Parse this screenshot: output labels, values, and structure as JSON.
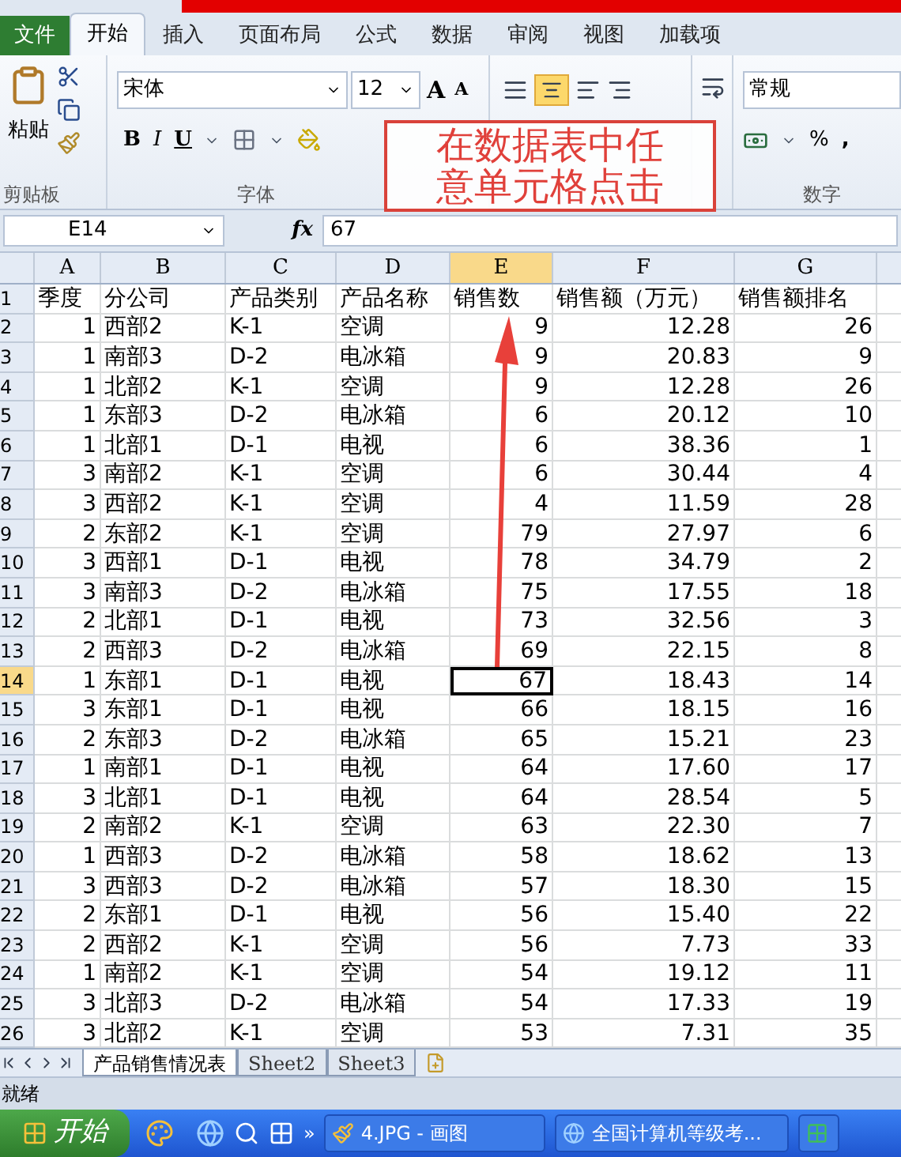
{
  "ribbon_tabs": [
    {
      "label": "文件",
      "kind": "file",
      "selected": false
    },
    {
      "label": "开始",
      "kind": "tab",
      "selected": true
    },
    {
      "label": "插入",
      "kind": "tab",
      "selected": false
    },
    {
      "label": "页面布局",
      "kind": "tab",
      "selected": false
    },
    {
      "label": "公式",
      "kind": "tab",
      "selected": false
    },
    {
      "label": "数据",
      "kind": "tab",
      "selected": false
    },
    {
      "label": "审阅",
      "kind": "tab",
      "selected": false
    },
    {
      "label": "视图",
      "kind": "tab",
      "selected": false
    },
    {
      "label": "加载项",
      "kind": "tab",
      "selected": false
    }
  ],
  "clipboard": {
    "paste": "粘贴",
    "group": "剪贴板"
  },
  "font": {
    "name": "宋体",
    "size": "12",
    "group": "字体",
    "style_buttons": [
      "B",
      "I",
      "U"
    ],
    "grow": "A",
    "shrink": "A"
  },
  "number": {
    "format": "常规",
    "group": "数字",
    "percent": "%",
    "comma": ","
  },
  "name_box": "E14",
  "fx": "fx",
  "formula": "67",
  "columns": [
    {
      "label": "A",
      "selected": false
    },
    {
      "label": "B",
      "selected": false
    },
    {
      "label": "C",
      "selected": false
    },
    {
      "label": "D",
      "selected": false
    },
    {
      "label": "E",
      "selected": true
    },
    {
      "label": "F",
      "selected": false
    },
    {
      "label": "G",
      "selected": false
    }
  ],
  "rows": [
    {
      "num": "1",
      "selected": false,
      "cells": [
        "季度",
        "分公司",
        "产品类别",
        "产品名称",
        "销售数",
        "销售额（万元）",
        "销售额排名"
      ]
    },
    {
      "num": "2",
      "selected": false,
      "cells": [
        "1",
        "西部2",
        "K-1",
        "空调",
        "9",
        "12.28",
        "26"
      ]
    },
    {
      "num": "3",
      "selected": false,
      "cells": [
        "1",
        "南部3",
        "D-2",
        "电冰箱",
        "9",
        "20.83",
        "9"
      ]
    },
    {
      "num": "4",
      "selected": false,
      "cells": [
        "1",
        "北部2",
        "K-1",
        "空调",
        "9",
        "12.28",
        "26"
      ]
    },
    {
      "num": "5",
      "selected": false,
      "cells": [
        "1",
        "东部3",
        "D-2",
        "电冰箱",
        "6",
        "20.12",
        "10"
      ]
    },
    {
      "num": "6",
      "selected": false,
      "cells": [
        "1",
        "北部1",
        "D-1",
        "电视",
        "6",
        "38.36",
        "1"
      ]
    },
    {
      "num": "7",
      "selected": false,
      "cells": [
        "3",
        "南部2",
        "K-1",
        "空调",
        "6",
        "30.44",
        "4"
      ]
    },
    {
      "num": "8",
      "selected": false,
      "cells": [
        "3",
        "西部2",
        "K-1",
        "空调",
        "4",
        "11.59",
        "28"
      ]
    },
    {
      "num": "9",
      "selected": false,
      "cells": [
        "2",
        "东部2",
        "K-1",
        "空调",
        "79",
        "27.97",
        "6"
      ]
    },
    {
      "num": "10",
      "selected": false,
      "cells": [
        "3",
        "西部1",
        "D-1",
        "电视",
        "78",
        "34.79",
        "2"
      ]
    },
    {
      "num": "11",
      "selected": false,
      "cells": [
        "3",
        "南部3",
        "D-2",
        "电冰箱",
        "75",
        "17.55",
        "18"
      ]
    },
    {
      "num": "12",
      "selected": false,
      "cells": [
        "2",
        "北部1",
        "D-1",
        "电视",
        "73",
        "32.56",
        "3"
      ]
    },
    {
      "num": "13",
      "selected": false,
      "cells": [
        "2",
        "西部3",
        "D-2",
        "电冰箱",
        "69",
        "22.15",
        "8"
      ]
    },
    {
      "num": "14",
      "selected": true,
      "cells": [
        "1",
        "东部1",
        "D-1",
        "电视",
        "67",
        "18.43",
        "14"
      ]
    },
    {
      "num": "15",
      "selected": false,
      "cells": [
        "3",
        "东部1",
        "D-1",
        "电视",
        "66",
        "18.15",
        "16"
      ]
    },
    {
      "num": "16",
      "selected": false,
      "cells": [
        "2",
        "东部3",
        "D-2",
        "电冰箱",
        "65",
        "15.21",
        "23"
      ]
    },
    {
      "num": "17",
      "selected": false,
      "cells": [
        "1",
        "南部1",
        "D-1",
        "电视",
        "64",
        "17.60",
        "17"
      ]
    },
    {
      "num": "18",
      "selected": false,
      "cells": [
        "3",
        "北部1",
        "D-1",
        "电视",
        "64",
        "28.54",
        "5"
      ]
    },
    {
      "num": "19",
      "selected": false,
      "cells": [
        "2",
        "南部2",
        "K-1",
        "空调",
        "63",
        "22.30",
        "7"
      ]
    },
    {
      "num": "20",
      "selected": false,
      "cells": [
        "1",
        "西部3",
        "D-2",
        "电冰箱",
        "58",
        "18.62",
        "13"
      ]
    },
    {
      "num": "21",
      "selected": false,
      "cells": [
        "3",
        "西部3",
        "D-2",
        "电冰箱",
        "57",
        "18.30",
        "15"
      ]
    },
    {
      "num": "22",
      "selected": false,
      "cells": [
        "2",
        "东部1",
        "D-1",
        "电视",
        "56",
        "15.40",
        "22"
      ]
    },
    {
      "num": "23",
      "selected": false,
      "cells": [
        "2",
        "西部2",
        "K-1",
        "空调",
        "56",
        "7.73",
        "33"
      ]
    },
    {
      "num": "24",
      "selected": false,
      "cells": [
        "1",
        "南部2",
        "K-1",
        "空调",
        "54",
        "19.12",
        "11"
      ]
    },
    {
      "num": "25",
      "selected": false,
      "cells": [
        "3",
        "北部3",
        "D-2",
        "电冰箱",
        "54",
        "17.33",
        "19"
      ]
    },
    {
      "num": "26",
      "selected": false,
      "cells": [
        "3",
        "北部2",
        "K-1",
        "空调",
        "53",
        "7.31",
        "35"
      ]
    }
  ],
  "sheet_tabs": [
    {
      "label": "产品销售情况表",
      "selected": true
    },
    {
      "label": "Sheet2",
      "selected": false
    },
    {
      "label": "Sheet3",
      "selected": false
    }
  ],
  "status": "就绪",
  "annotation": [
    "在数据表中任",
    "意单元格点击"
  ],
  "taskbar": {
    "start": "开始",
    "overflow": "»",
    "tasks": [
      {
        "label": "4.JPG - 画图",
        "kind": "paint"
      },
      {
        "label": "全国计算机等级考...",
        "kind": "browser"
      },
      {
        "kind": "excel"
      }
    ]
  }
}
